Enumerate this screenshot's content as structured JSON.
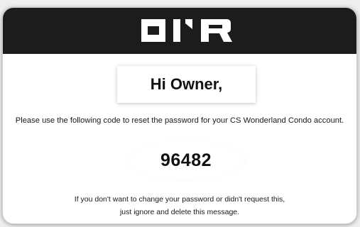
{
  "brand": {
    "logo_text": "ONR",
    "header_color": "#1c1c1c"
  },
  "email": {
    "greeting": "Hi Owner,",
    "instruction": "Please use the following code to reset the password for your CS Wonderland Condo account.",
    "code": "96482",
    "note_line1": "If you don't want to change your password or didn't request this,",
    "note_line2": "just ignore and delete this message."
  }
}
